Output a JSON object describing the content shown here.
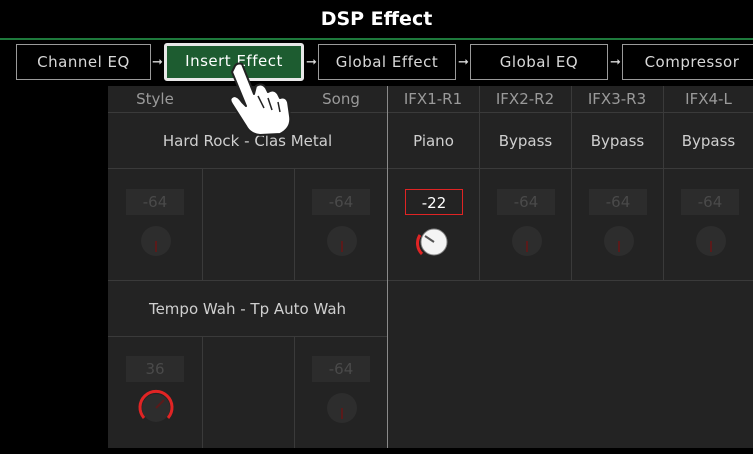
{
  "title": "DSP Effect",
  "tabs": [
    {
      "label": "Channel EQ"
    },
    {
      "label": "Insert Effect"
    },
    {
      "label": "Global Effect"
    },
    {
      "label": "Global EQ"
    },
    {
      "label": "Compressor"
    }
  ],
  "columns": {
    "style": "Style",
    "song": "Song",
    "ifx": [
      "IFX1-R1",
      "IFX2-R2",
      "IFX3-R3",
      "IFX4-L"
    ]
  },
  "style_song": {
    "row1_name": "Hard Rock - Clas Metal",
    "row1_style_value": "-64",
    "row1_song_value": "-64",
    "row2_name": "Tempo Wah - Tp Auto Wah",
    "row2_style_value": "36",
    "row2_song_value": "-64"
  },
  "ifx_names": [
    "Piano",
    "Bypass",
    "Bypass",
    "Bypass"
  ],
  "ifx_values": [
    "-22",
    "-64",
    "-64",
    "-64"
  ],
  "colors": {
    "accent_green": "#1d5c30",
    "indicator_red": "#e02424"
  },
  "icons": {
    "pointer": "hand-pointer-icon"
  }
}
